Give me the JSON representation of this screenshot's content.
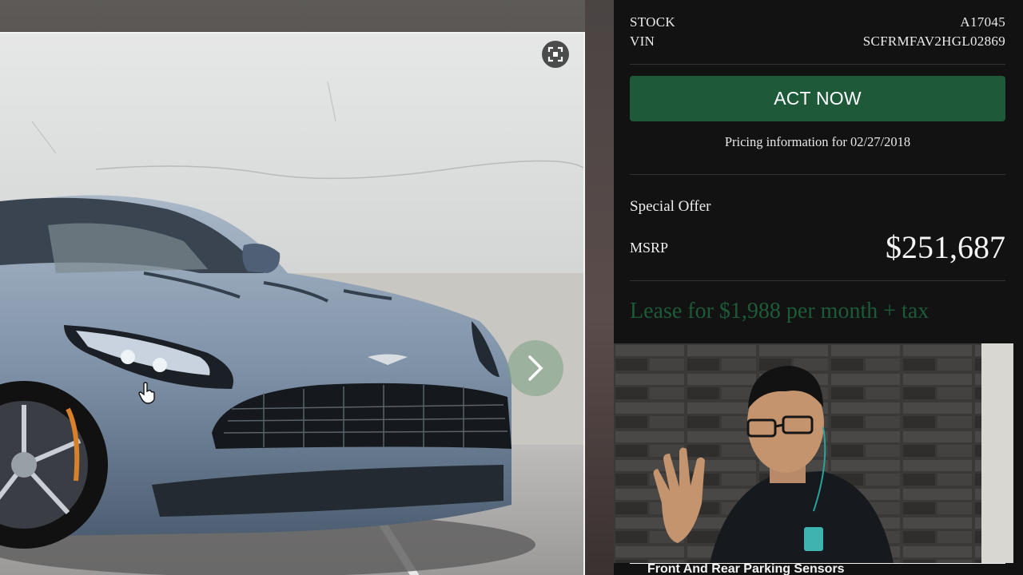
{
  "vehicle": {
    "stock_label": "STOCK",
    "stock_value": "A17045",
    "vin_label": "VIN",
    "vin_value": "SCFRMFAV2HGL02869"
  },
  "cta": {
    "act_now_label": "ACT NOW",
    "pricing_info": "Pricing information for 02/27/2018"
  },
  "pricing": {
    "special_offer_label": "Special Offer",
    "msrp_label": "MSRP",
    "msrp_value": "$251,687",
    "lease_text": "Lease for $1,988 per month + tax"
  },
  "features": {
    "partial_item": "Front And Rear Parking Sensors"
  },
  "icons": {
    "fullscreen": "fullscreen-icon",
    "next": "chevron-right-icon",
    "cursor": "hand-cursor-icon"
  },
  "colors": {
    "accent_green": "#1e5a3a",
    "panel_bg": "#121212",
    "lease_green": "#1d5a38"
  }
}
